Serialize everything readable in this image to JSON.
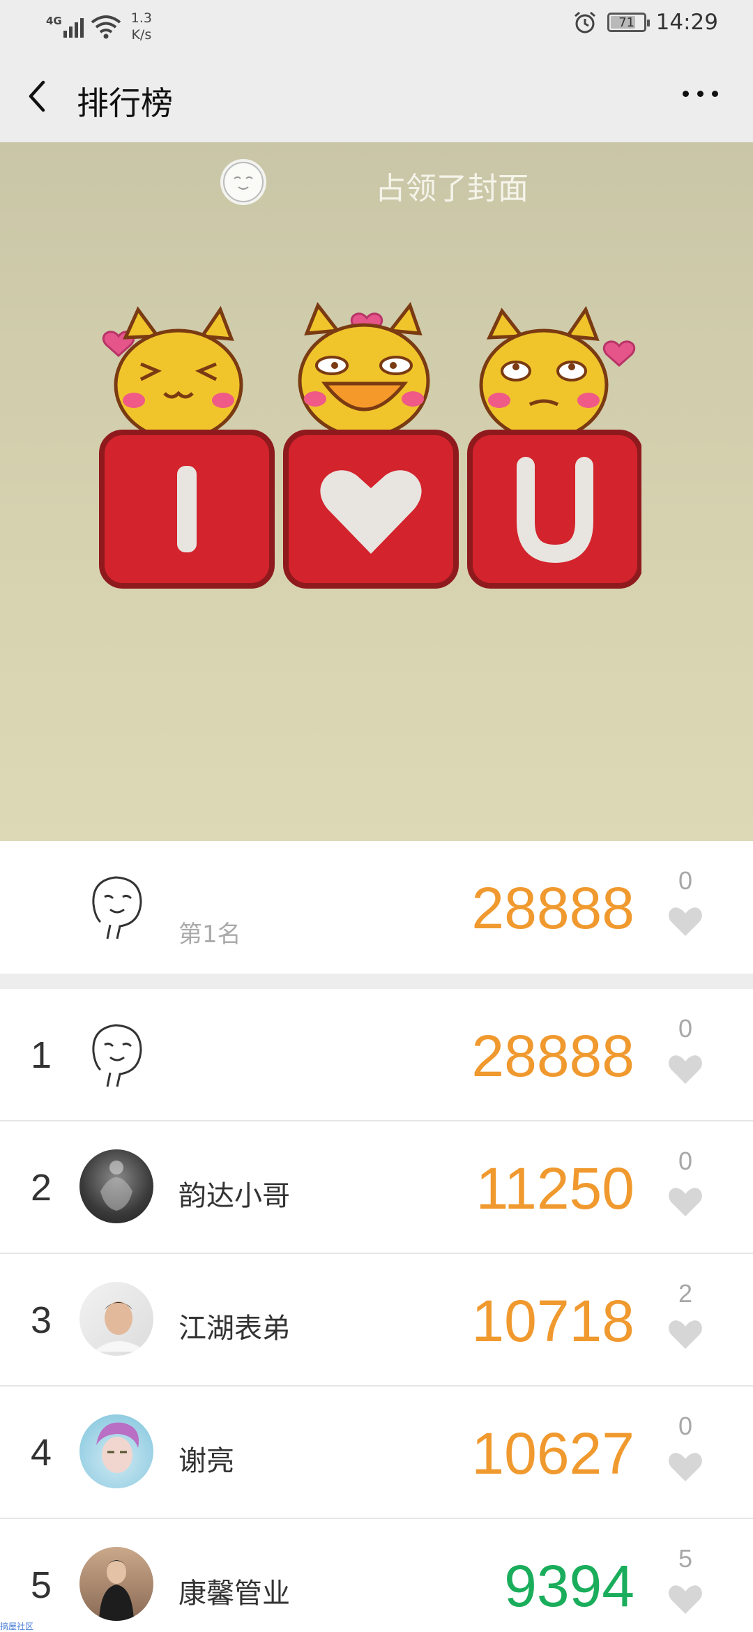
{
  "status_bar": {
    "network": "4G",
    "speed_value": "1.3",
    "speed_unit": "K/s",
    "battery": "71",
    "time": "14:29"
  },
  "header": {
    "title": "排行榜"
  },
  "cover": {
    "text": "占领了封面"
  },
  "my_rank": {
    "subtitle": "第1名",
    "score": "28888",
    "likes": "0"
  },
  "ranking": [
    {
      "rank": "1",
      "name": "",
      "score": "28888",
      "likes": "0",
      "score_color": "#f0992e"
    },
    {
      "rank": "2",
      "name": "韵达小哥",
      "score": "11250",
      "likes": "0",
      "score_color": "#f0992e"
    },
    {
      "rank": "3",
      "name": "江湖表弟",
      "score": "10718",
      "likes": "2",
      "score_color": "#f0992e"
    },
    {
      "rank": "4",
      "name": "谢亮",
      "score": "10627",
      "likes": "0",
      "score_color": "#f0992e"
    },
    {
      "rank": "5",
      "name": "康馨管业",
      "score": "9394",
      "likes": "5",
      "score_color": "#1aad5b"
    }
  ],
  "watermark": "搞屋社区"
}
